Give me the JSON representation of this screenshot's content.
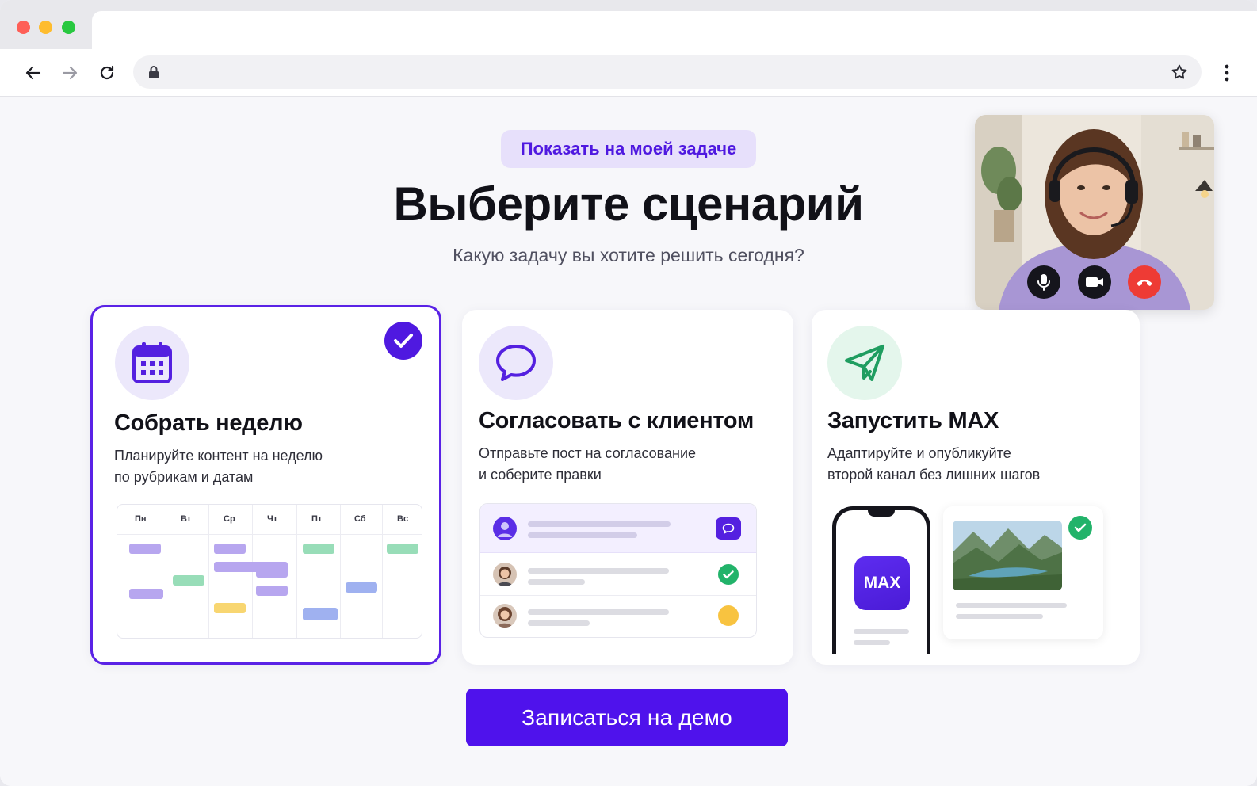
{
  "browser": {
    "url": "",
    "icons": [
      "arrow-left-icon",
      "arrow-right-icon",
      "reload-icon",
      "lock-icon",
      "star-icon",
      "more-vertical-icon"
    ]
  },
  "hero": {
    "pill_label": "Показать на моей задаче",
    "title": "Выберите сценарий",
    "subtitle": "Какую задачу вы хотите решить сегодня?"
  },
  "cards": [
    {
      "title": "Собрать неделю",
      "desc_line1": "Планируйте контент на неделю",
      "desc_line2": "по рубрикам и датам",
      "icon": "calendar-icon",
      "selected": true,
      "calendar_days": [
        "Пн",
        "Вт",
        "Ср",
        "Чт",
        "Пт",
        "Сб",
        "Вс"
      ]
    },
    {
      "title": "Согласовать с клиентом",
      "desc_line1": "Отправьте пост на согласование",
      "desc_line2": "и соберите правки",
      "icon": "chat-bubble-icon",
      "selected": false
    },
    {
      "title": "Запустить MAX",
      "desc_line1": "Адаптируйте и опубликуйте",
      "desc_line2": "второй канал без лишних шагов",
      "icon": "send-icon",
      "selected": false,
      "app_logo": "MAX"
    }
  ],
  "video_call": {
    "controls": [
      "microphone-icon",
      "camera-icon",
      "end-call-icon"
    ]
  },
  "cta_label": "Записаться на демо",
  "colors": {
    "accent": "#4f12ec",
    "pill_bg": "#e7e0fb",
    "success": "#22b36a",
    "pending": "#f8c340",
    "end_call": "#ee3b35"
  }
}
